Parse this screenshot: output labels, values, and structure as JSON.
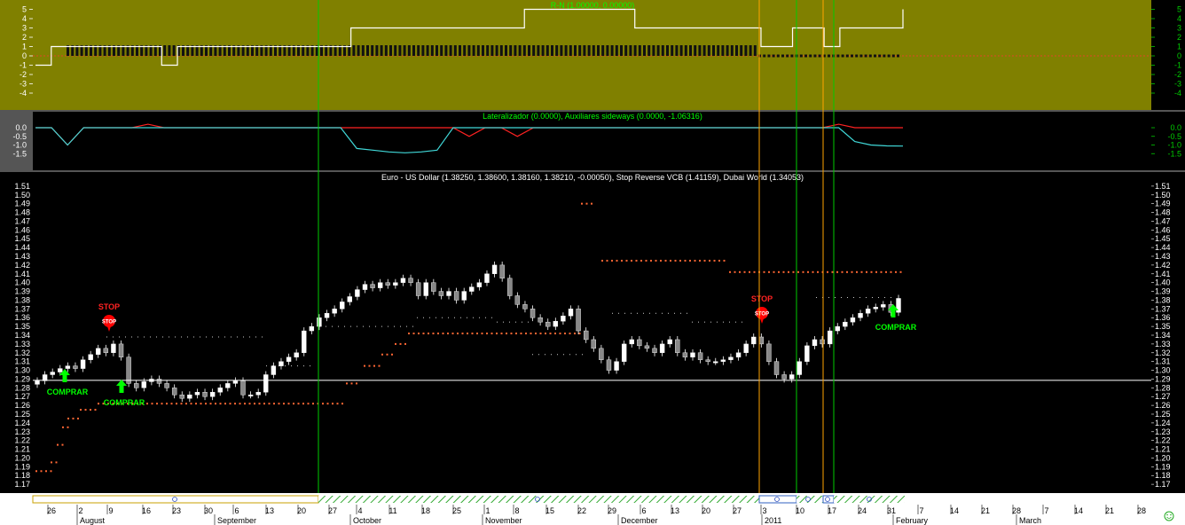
{
  "colors": {
    "panel1_bg": "#808000",
    "bg": "#000000",
    "white": "#ffffff",
    "green": "#00ff00",
    "orange_line": "#ffa500",
    "red": "#ff0000",
    "cyan": "#40d8d8",
    "dot_orange": "#ff6633",
    "axis_bg": "#ffffff",
    "hatch_green": "#33aa33"
  },
  "panels": {
    "p1": {
      "title": "R-N (1.00000, 0.00000)",
      "y_ticks": [
        "5",
        "4",
        "3",
        "2",
        "1",
        "0",
        "-1",
        "-2",
        "-3",
        "-4"
      ],
      "right_ticks": [
        "5",
        "4",
        "3",
        "2",
        "1",
        "0",
        "-1",
        "-2",
        "-3",
        "-4"
      ]
    },
    "p2": {
      "title": "Lateralizador (0.0000), Auxiliares sideways (0.0000, -1.06316)",
      "y_ticks": [
        "0.0",
        "-0.5",
        "-1.0",
        "-1.5"
      ],
      "right_ticks": [
        "0.0",
        "-0.5",
        "-1.0",
        "-1.5"
      ]
    },
    "p3": {
      "title": "Euro - US Dollar (1.38250, 1.38600, 1.38160, 1.38210, -0.00050), Stop Reverse VCB (1.41159), Dubai World (1.34053)",
      "y_ticks": [
        "1.51",
        "1.50",
        "1.49",
        "1.48",
        "1.47",
        "1.46",
        "1.45",
        "1.44",
        "1.43",
        "1.42",
        "1.41",
        "1.40",
        "1.39",
        "1.38",
        "1.37",
        "1.36",
        "1.35",
        "1.34",
        "1.33",
        "1.32",
        "1.31",
        "1.30",
        "1.29",
        "1.28",
        "1.27",
        "1.26",
        "1.25",
        "1.24",
        "1.23",
        "1.22",
        "1.21",
        "1.20",
        "1.19",
        "1.18",
        "1.17"
      ]
    }
  },
  "signals": [
    {
      "text": "COMPRAR",
      "kind": "buy",
      "idx": "a"
    },
    {
      "text": "COMPRAR",
      "kind": "buy",
      "idx": "b"
    },
    {
      "text": "COMPRAR",
      "kind": "buy",
      "idx": "c"
    },
    {
      "text": "STOP",
      "kind": "stop",
      "idx": "a"
    },
    {
      "text": "STOP",
      "kind": "stop",
      "idx": "b"
    }
  ],
  "stop_icon_text": "STOP",
  "x_axis": {
    "day_labels": [
      "26",
      "2",
      "9",
      "16",
      "23",
      "30",
      "6",
      "13",
      "20",
      "27",
      "4",
      "11",
      "18",
      "25",
      "1",
      "8",
      "15",
      "22",
      "29",
      "6",
      "13",
      "20",
      "27",
      "3",
      "10",
      "17",
      "24",
      "31",
      "7",
      "14",
      "21",
      "28",
      "7",
      "14",
      "21",
      "28"
    ],
    "month_labels": [
      "August",
      "September",
      "October",
      "November",
      "December",
      "2011",
      "February",
      "March"
    ]
  },
  "chart_data": [
    {
      "type": "line",
      "title": "R-N (1.00000, 0.00000)",
      "ylim": [
        -5,
        5
      ],
      "series": [
        {
          "name": "R-N",
          "values": [
            -1,
            1,
            1,
            1,
            1,
            1,
            1,
            1,
            -1,
            1,
            1,
            1,
            1,
            1,
            1,
            1,
            1,
            1,
            1,
            1,
            3,
            3,
            3,
            3,
            3,
            3,
            3,
            3,
            3,
            3,
            3,
            5,
            5,
            5,
            5,
            5,
            5,
            5,
            3,
            3,
            3,
            3,
            3,
            3,
            3,
            3,
            1,
            1,
            3,
            3,
            1,
            3,
            3,
            3,
            3,
            5
          ]
        }
      ]
    },
    {
      "type": "line",
      "title": "Lateralizador (0.0000), Auxiliares sideways (0.0000, -1.06316)",
      "ylim": [
        -1.6,
        0.2
      ],
      "series": [
        {
          "name": "Lateralizador",
          "values": [
            0,
            0,
            -1,
            0,
            0,
            0,
            0,
            0.2,
            0,
            0,
            0,
            0,
            0,
            0,
            0,
            0,
            0,
            0,
            0,
            0,
            0,
            0,
            0,
            0,
            0,
            0,
            0,
            -0.5,
            0,
            0,
            -0.5,
            0,
            0,
            0,
            0,
            0,
            0,
            0,
            0,
            0,
            0,
            0,
            0,
            0,
            0,
            0,
            0,
            0,
            0,
            0,
            0.2,
            0,
            0,
            0,
            0
          ]
        },
        {
          "name": "Auxiliares sideways",
          "values": [
            0,
            0,
            -1,
            0,
            0,
            0,
            0,
            0,
            0,
            0,
            0,
            0,
            0,
            0,
            0,
            0,
            0,
            0,
            0,
            0,
            -1.2,
            -1.3,
            -1.4,
            -1.45,
            -1.4,
            -1.3,
            0,
            0,
            0,
            0,
            0,
            0,
            0,
            0,
            0,
            0,
            0,
            0,
            0,
            0,
            0,
            0,
            0,
            0,
            0,
            0,
            0,
            0,
            0,
            0,
            0,
            -0.8,
            -1.0,
            -1.05,
            -1.06
          ]
        }
      ]
    },
    {
      "type": "candlestick",
      "title": "Euro - US Dollar (1.38250, 1.38600, 1.38160, 1.38210, -0.00050), Stop Reverse VCB (1.41159), Dubai World (1.34053)",
      "ylim": [
        1.16,
        1.52
      ],
      "x_range": [
        "2010-07-23",
        "2011-03-03"
      ],
      "last": {
        "open": 1.3825,
        "high": 1.386,
        "low": 1.3816,
        "close": 1.3821,
        "change": -0.0005
      },
      "indicators": {
        "Stop Reverse VCB": 1.41159,
        "Dubai World": 1.34053
      },
      "horizontal_line": 1.2885,
      "closes": [
        1.288,
        1.295,
        1.298,
        1.302,
        1.305,
        1.302,
        1.312,
        1.318,
        1.325,
        1.32,
        1.33,
        1.315,
        1.285,
        1.28,
        1.287,
        1.29,
        1.285,
        1.28,
        1.272,
        1.268,
        1.272,
        1.275,
        1.27,
        1.275,
        1.28,
        1.285,
        1.288,
        1.272,
        1.272,
        1.275,
        1.295,
        1.305,
        1.31,
        1.315,
        1.32,
        1.345,
        1.35,
        1.36,
        1.365,
        1.37,
        1.378,
        1.384,
        1.392,
        1.398,
        1.394,
        1.4,
        1.397,
        1.4,
        1.405,
        1.4,
        1.385,
        1.4,
        1.39,
        1.385,
        1.39,
        1.38,
        1.39,
        1.395,
        1.4,
        1.41,
        1.42,
        1.405,
        1.385,
        1.375,
        1.37,
        1.36,
        1.355,
        1.35,
        1.356,
        1.362,
        1.37,
        1.345,
        1.335,
        1.325,
        1.312,
        1.3,
        1.31,
        1.33,
        1.335,
        1.328,
        1.325,
        1.32,
        1.33,
        1.335,
        1.32,
        1.315,
        1.32,
        1.312,
        1.31,
        1.31,
        1.312,
        1.315,
        1.32,
        1.33,
        1.338,
        1.33,
        1.31,
        1.295,
        1.29,
        1.295,
        1.31,
        1.328,
        1.335,
        1.33,
        1.345,
        1.35,
        1.355,
        1.36,
        1.365,
        1.37,
        1.372,
        1.375,
        1.366,
        1.382
      ]
    }
  ]
}
